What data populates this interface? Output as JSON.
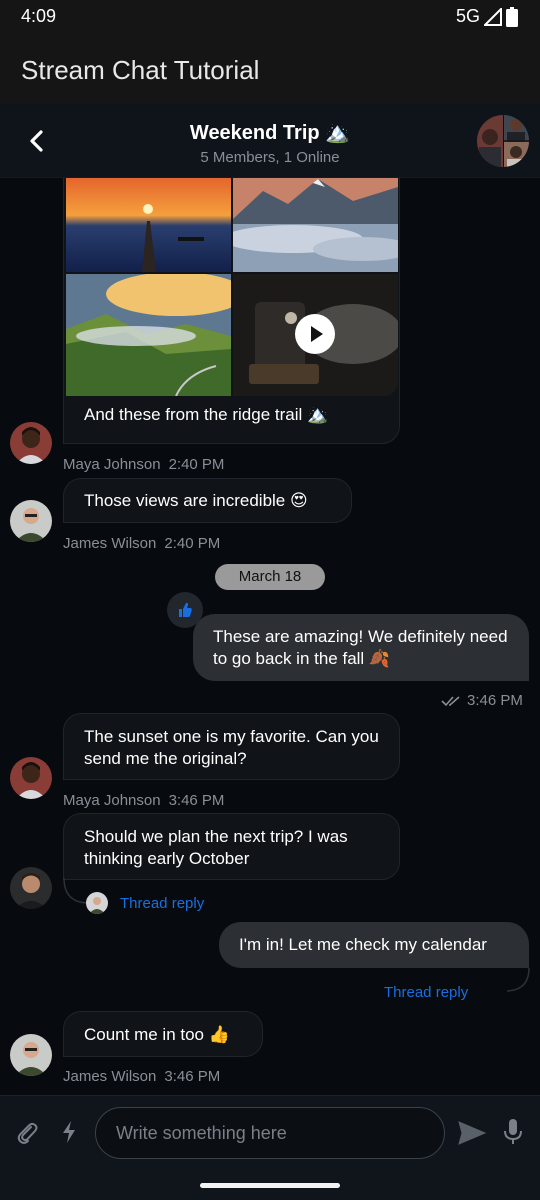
{
  "status": {
    "time": "4:09",
    "network": "5G"
  },
  "app": {
    "title": "Stream Chat Tutorial"
  },
  "channel": {
    "title": "Weekend Trip 🏔️",
    "subtitle": "5 Members, 1 Online"
  },
  "date_separator": "March 18",
  "messages": [
    {
      "id": "m1",
      "text": "And these from the ridge trail 🏔️",
      "author": "Maya Johnson",
      "time": "2:40 PM",
      "attachments": [
        "sunset-pier-image",
        "mountain-clouds-image",
        "valley-fog-image",
        "projector-video"
      ]
    },
    {
      "id": "m2",
      "text": "Those views are incredible 😍",
      "author": "James Wilson",
      "time": "2:40 PM"
    },
    {
      "id": "m3",
      "text": "These are amazing! We definitely need to go back in the fall 🍂",
      "time": "3:46 PM",
      "outgoing": true,
      "reaction": "thumbs-up-icon"
    },
    {
      "id": "m4",
      "text": "The sunset one is my favorite. Can you send me the original?",
      "author": "Maya Johnson",
      "time": "3:46 PM"
    },
    {
      "id": "m5",
      "text": "Should we plan the next trip? I was thinking early October",
      "thread_label": "Thread reply"
    },
    {
      "id": "m6",
      "text": "I'm in! Let me check my calendar",
      "thread_label": "Thread reply",
      "outgoing": true
    },
    {
      "id": "m7",
      "text": "Count me in too 👍",
      "author": "James Wilson",
      "time": "3:46 PM"
    }
  ],
  "composer": {
    "placeholder": "Write something here"
  },
  "colors": {
    "accent": "#1a6fe0",
    "background": "#070a0f",
    "incoming_bubble": "#101418",
    "outgoing_bubble": "#2c2f33"
  }
}
